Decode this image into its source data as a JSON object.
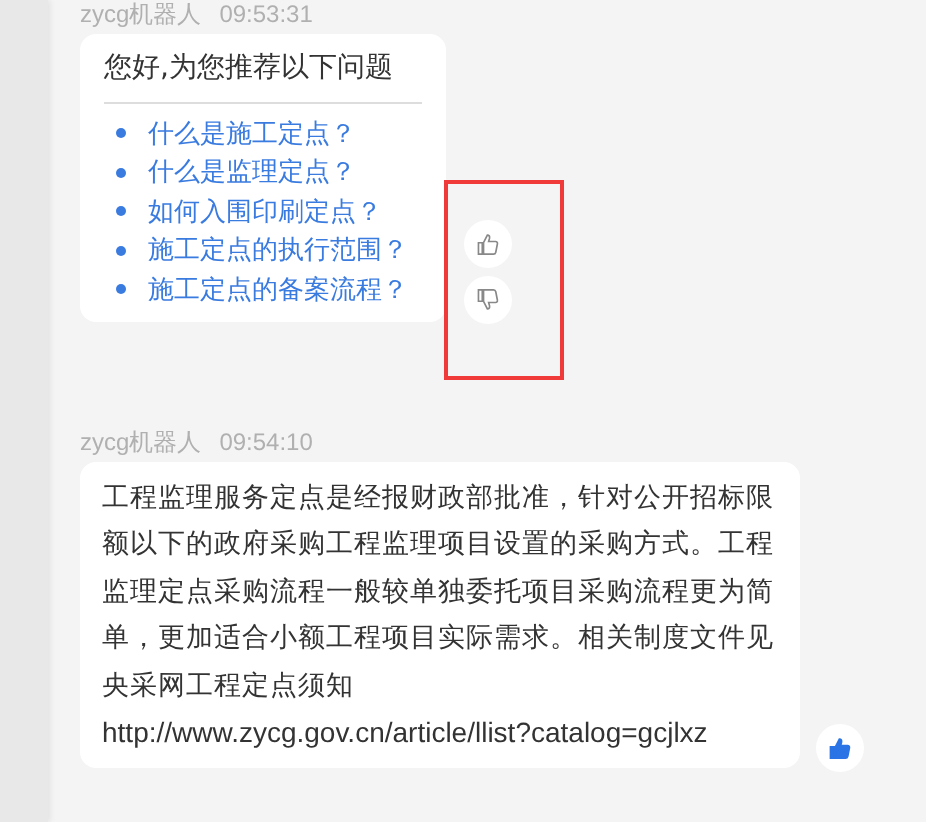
{
  "messages": [
    {
      "sender": "zycg机器人",
      "time": "09:53:31",
      "kind": "menu",
      "title": "您好,为您推荐以下问题",
      "questions": [
        "什么是施工定点？",
        "什么是监理定点？",
        "如何入围印刷定点？",
        "施工定点的执行范围？",
        "施工定点的备案流程？"
      ],
      "liked": false,
      "highlighted": true
    },
    {
      "sender": "zycg机器人",
      "time": "09:54:10",
      "kind": "text",
      "text": "工程监理服务定点是经报财政部批准，针对公开招标限额以下的政府采购工程监理项目设置的采购方式。工程监理定点采购流程一般较单独委托项目采购流程更为简单，更加适合小额工程项目实际需求。相关制度文件见央采网工程定点须知",
      "link": "http://www.zycg.gov.cn/article/llist?catalog=gcjlxz",
      "liked": true,
      "highlighted": false
    }
  ]
}
